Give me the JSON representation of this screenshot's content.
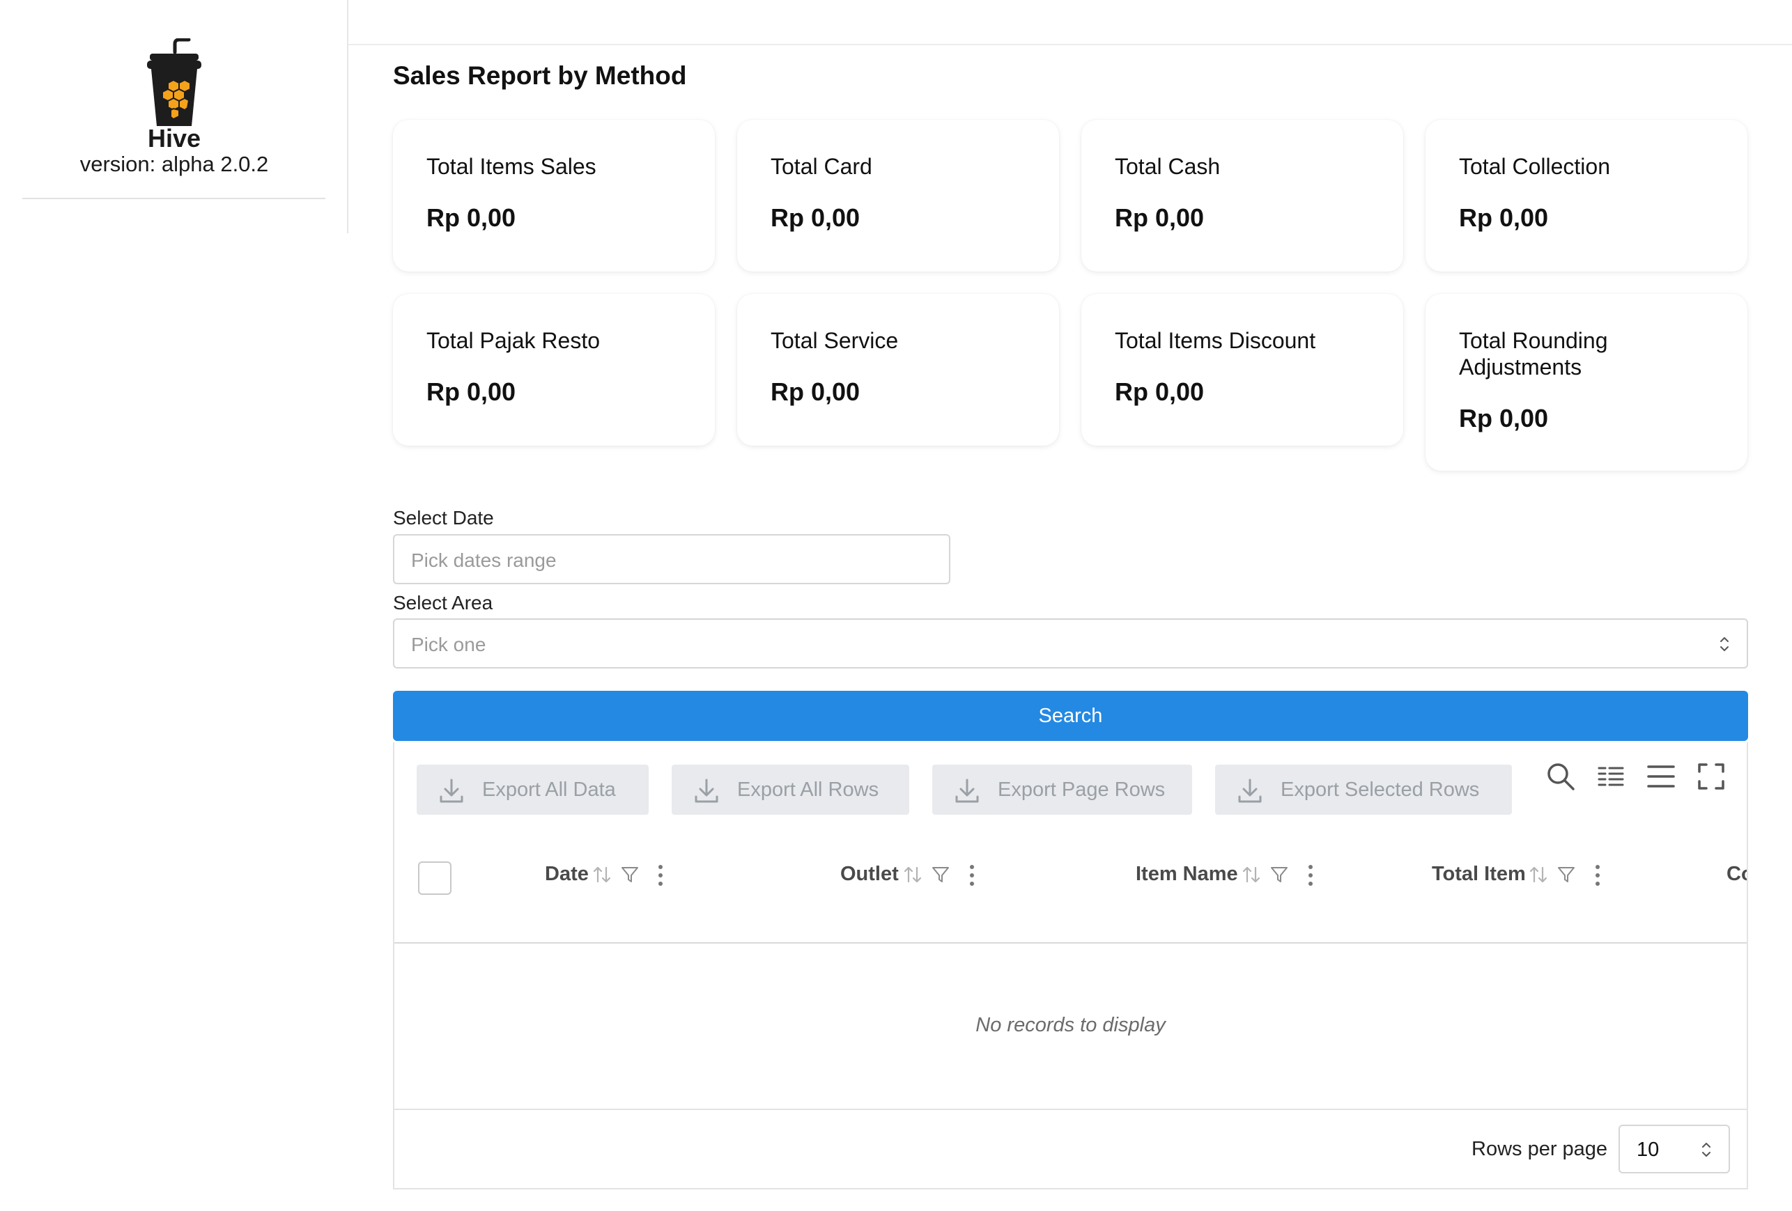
{
  "sidebar": {
    "app_name": "Hive",
    "version": "version: alpha 2.0.2",
    "logo_icon": "hive-cup-logo"
  },
  "page": {
    "title": "Sales Report by Method"
  },
  "cards": [
    {
      "label": "Total Items Sales",
      "value": "Rp 0,00"
    },
    {
      "label": "Total Card",
      "value": "Rp 0,00"
    },
    {
      "label": "Total Cash",
      "value": "Rp 0,00"
    },
    {
      "label": "Total Collection",
      "value": "Rp 0,00"
    },
    {
      "label": "Total Pajak Resto",
      "value": "Rp 0,00"
    },
    {
      "label": "Total Service",
      "value": "Rp 0,00"
    },
    {
      "label": "Total Items Discount",
      "value": "Rp 0,00"
    },
    {
      "label": "Total Rounding Adjustments",
      "value": "Rp 0,00"
    }
  ],
  "form": {
    "date_label": "Select Date",
    "date_placeholder": "Pick dates range",
    "area_label": "Select Area",
    "area_placeholder": "Pick one",
    "search_label": "Search"
  },
  "table": {
    "export_buttons": [
      "Export All Data",
      "Export All Rows",
      "Export Page Rows",
      "Export Selected Rows"
    ],
    "toolbar_icons": [
      "search-icon",
      "columns-icon",
      "density-icon",
      "fullscreen-icon"
    ],
    "columns": [
      "Date",
      "Outlet",
      "Item Name",
      "Total Item",
      "Co"
    ],
    "empty_message": "No records to display",
    "rows_per_page_label": "Rows per page",
    "rows_per_page_value": "10"
  },
  "colors": {
    "primary": "#2389e3",
    "logo_orange": "#f5a21b",
    "logo_dark": "#1d1d1d"
  }
}
